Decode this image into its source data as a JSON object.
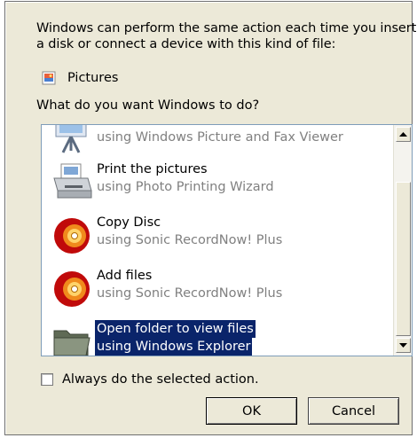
{
  "intro": {
    "line1": "Windows can perform the same action each time you insert",
    "line2": "a disk or connect a device with this kind of file:"
  },
  "content_type": {
    "label": "Pictures",
    "icon": "pictures-file-icon"
  },
  "question": "What do you want Windows to do?",
  "actions": [
    {
      "title": "",
      "subtitle": "using Windows Picture and Fax Viewer",
      "icon": "picture-viewer-icon",
      "selected": false
    },
    {
      "title": "Print the pictures",
      "subtitle": "using Photo Printing Wizard",
      "icon": "printer-icon",
      "selected": false
    },
    {
      "title": "Copy Disc",
      "subtitle": "using Sonic RecordNow! Plus",
      "icon": "sonic-disc-icon",
      "selected": false
    },
    {
      "title": "Add files",
      "subtitle": "using Sonic RecordNow! Plus",
      "icon": "sonic-disc-icon",
      "selected": false
    },
    {
      "title": "Open folder to view files",
      "subtitle": "using Windows Explorer",
      "icon": "folder-icon",
      "selected": true
    }
  ],
  "always_do": {
    "label": "Always do the selected action.",
    "checked": false
  },
  "buttons": {
    "ok": "OK",
    "cancel": "Cancel"
  },
  "colors": {
    "dialog_bg": "#ece9d8",
    "selection_bg": "#0a246a",
    "subtitle_gray": "#808080"
  }
}
